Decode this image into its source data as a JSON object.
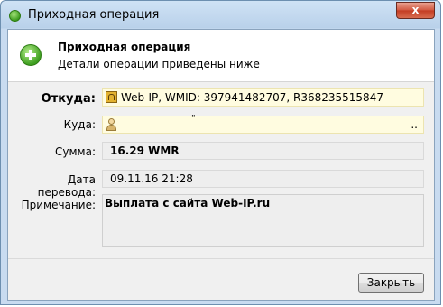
{
  "window": {
    "title": "Приходная операция",
    "close_glyph": "x"
  },
  "header": {
    "title": "Приходная операция",
    "subtitle": "Детали операции приведены ниже"
  },
  "form": {
    "from": {
      "label": "Откуда:",
      "value": "Web-IP, WMID: 397941482707, R368235515847"
    },
    "to": {
      "label": "Куда:",
      "value": "",
      "mark": "\"",
      "trailing": ".."
    },
    "amount": {
      "label": "Сумма:",
      "value": "16.29 WMR"
    },
    "date": {
      "label": "Дата перевода:",
      "value": "09.11.16 21:28"
    },
    "note": {
      "label": "Примечание:",
      "value": "Выплата с сайта Web-IP.ru"
    }
  },
  "footer": {
    "close_label": "Закрыть"
  },
  "colors": {
    "accent_green": "#3e9f20",
    "close_red": "#c33b22",
    "field_yellow": "#fffce0"
  },
  "icons": {
    "title": "plus-circle-icon",
    "header": "plus-circle-icon",
    "from": "wallet-icon",
    "to": "user-icon"
  }
}
